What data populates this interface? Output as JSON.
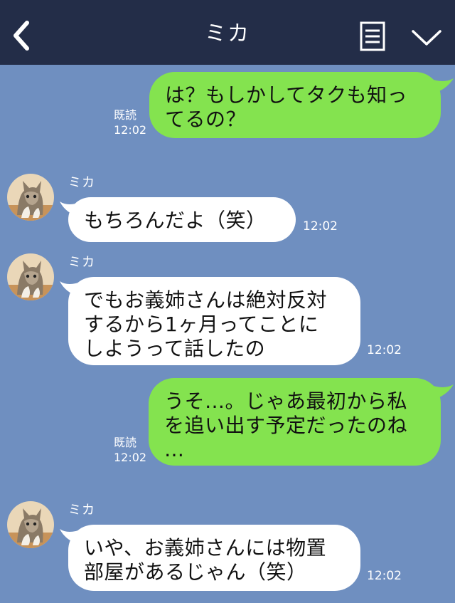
{
  "header": {
    "title": "ミカ"
  },
  "messages": [
    {
      "id": "m1",
      "side": "right",
      "lines": [
        "は？もしかしてタクも知っ",
        "てるの？"
      ],
      "read": "既読",
      "time": "12:02"
    },
    {
      "id": "m2",
      "side": "left",
      "sender": "ミカ",
      "lines": [
        "もちろんだよ（笑）"
      ],
      "time": "12:02"
    },
    {
      "id": "m3",
      "side": "left",
      "sender": "ミカ",
      "lines": [
        "でもお義姉さんは絶対反対",
        "するから1ヶ月ってことに",
        "しようって話したの"
      ],
      "time": "12:02"
    },
    {
      "id": "m4",
      "side": "right",
      "lines": [
        "うそ…。じゃあ最初から私",
        "を追い出す予定だったのね",
        "…"
      ],
      "read": "既読",
      "time": "12:02"
    },
    {
      "id": "m5",
      "side": "left",
      "sender": "ミカ",
      "lines": [
        "いや、お義姉さんには物置",
        "部屋があるじゃん（笑）"
      ],
      "time": "12:02"
    }
  ],
  "colors": {
    "background": "#6f8fc0",
    "header": "#232d48",
    "sent_bubble": "#84e34f",
    "received_bubble": "#ffffff"
  },
  "icons": [
    "back-icon",
    "menu-icon",
    "chevron-down-icon",
    "cat-avatar"
  ]
}
